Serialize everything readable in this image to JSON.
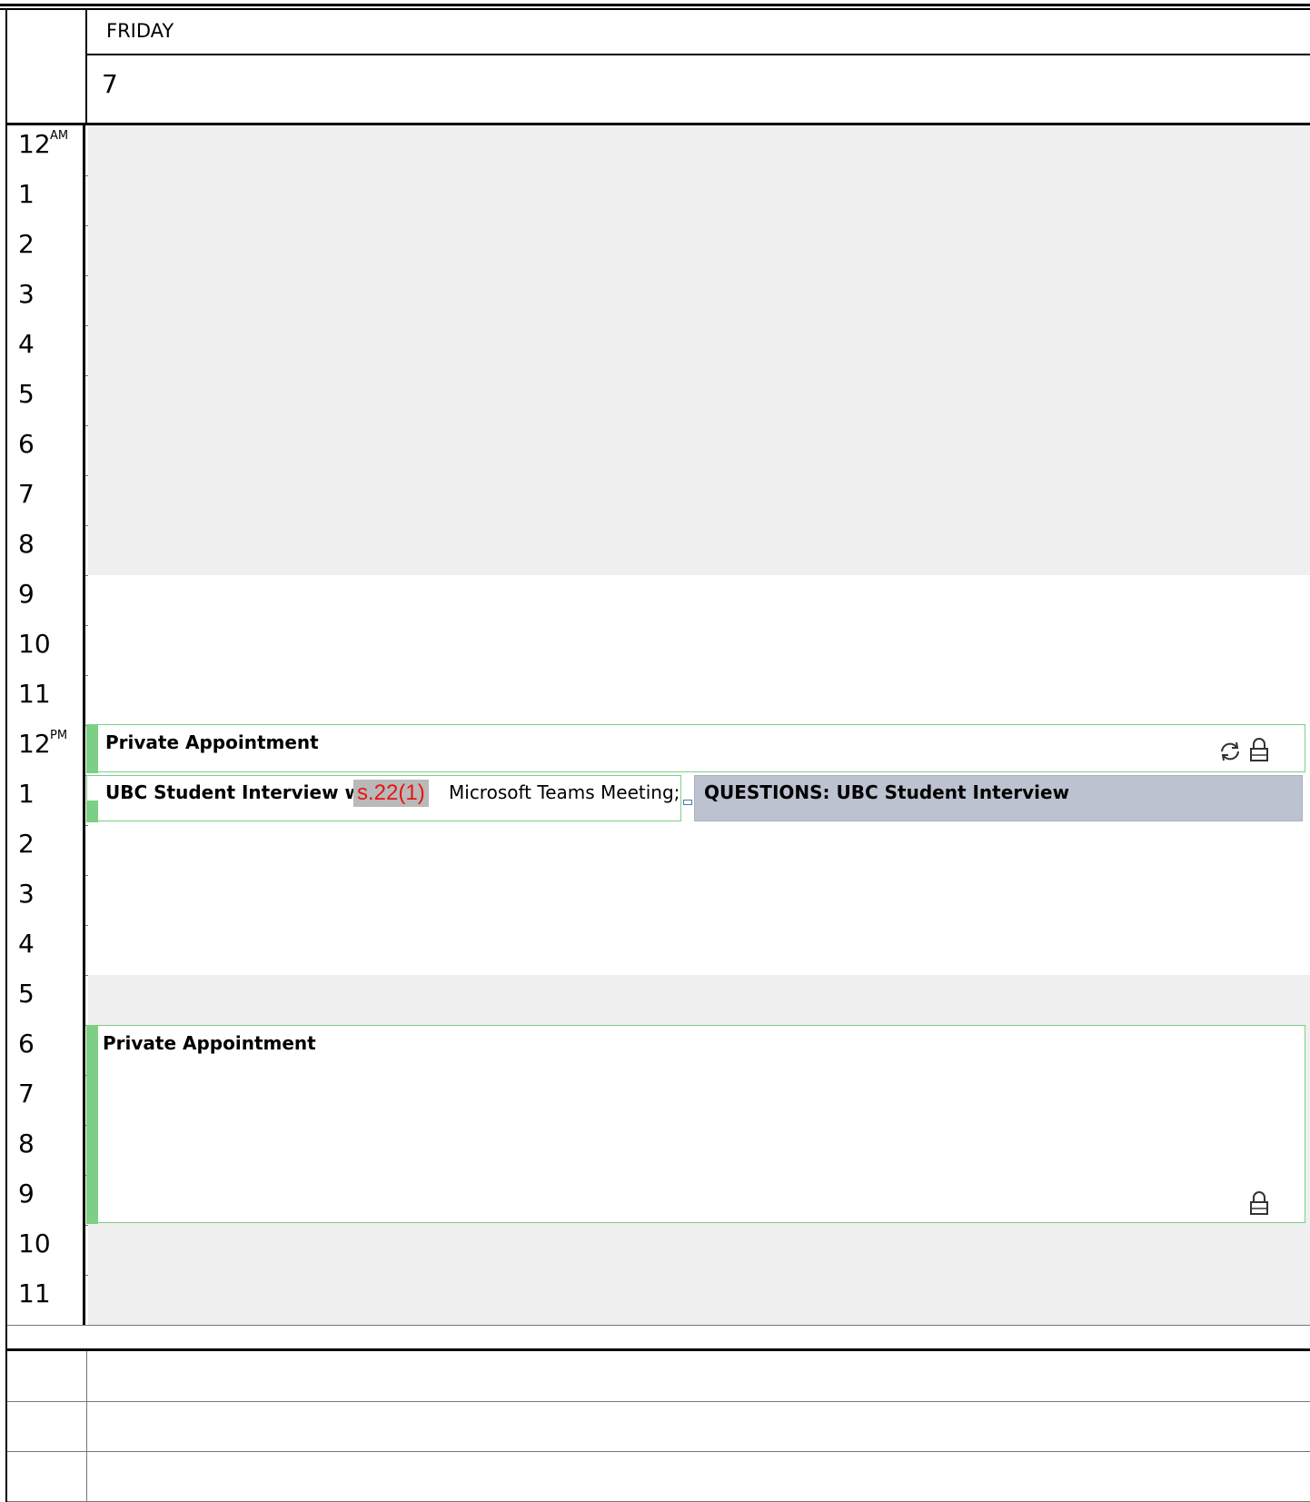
{
  "day": {
    "name": "FRIDAY",
    "number": "7"
  },
  "hours": [
    {
      "label": "12",
      "suffix": "AM"
    },
    {
      "label": "1"
    },
    {
      "label": "2"
    },
    {
      "label": "3"
    },
    {
      "label": "4"
    },
    {
      "label": "5"
    },
    {
      "label": "6"
    },
    {
      "label": "7"
    },
    {
      "label": "8"
    },
    {
      "label": "9"
    },
    {
      "label": "10"
    },
    {
      "label": "11"
    },
    {
      "label": "12",
      "suffix": "PM"
    },
    {
      "label": "1"
    },
    {
      "label": "2"
    },
    {
      "label": "3"
    },
    {
      "label": "4"
    },
    {
      "label": "5"
    },
    {
      "label": "6"
    },
    {
      "label": "7"
    },
    {
      "label": "8"
    },
    {
      "label": "9"
    },
    {
      "label": "10"
    },
    {
      "label": "11"
    }
  ],
  "events": {
    "noon_private": {
      "title": "Private Appointment",
      "icons": [
        "recurring-icon",
        "lock-icon"
      ]
    },
    "interview": {
      "title": "UBC Student Interview with",
      "redaction": "s.22(1)",
      "location": "Microsoft Teams Meeting;"
    },
    "questions": {
      "title": "QUESTIONS: UBC Student Interview"
    },
    "evening_private": {
      "title": "Private Appointment",
      "icons": [
        "lock-icon"
      ]
    }
  },
  "colors": {
    "event_accent": "#7ccf84",
    "off_hours": "#efefef",
    "questions_bg": "#bcc2cf",
    "redaction_text": "#e81414"
  }
}
